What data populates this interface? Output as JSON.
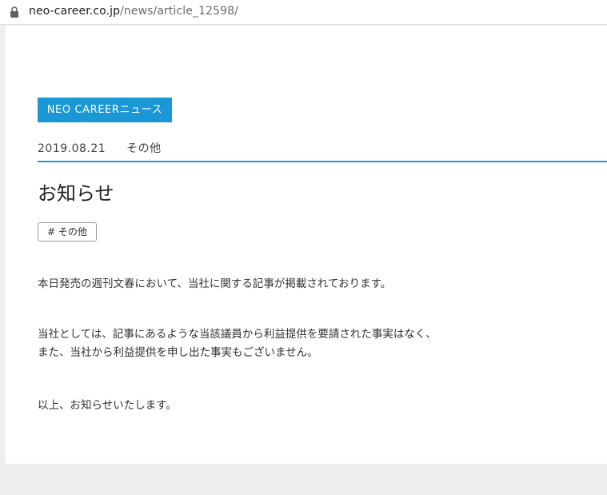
{
  "browser": {
    "url_domain": "neo-career.co.jp",
    "url_path": "/news/article_12598/"
  },
  "article": {
    "category_tag": "NEO CAREERニュース",
    "date": "2019.08.21",
    "category": "その他",
    "title": "お知らせ",
    "hashtag": "# その他",
    "paragraphs": {
      "p1": "本日発売の週刊文春において、当社に関する記事が掲載されております。",
      "p2_line1": "当社としては、記事にあるような当該議員から利益提供を要請された事実はなく、",
      "p2_line2": "また、当社から利益提供を申し出た事実もございません。",
      "p3": "以上、お知らせいたします。"
    }
  },
  "colors": {
    "accent": "#1a97d5",
    "page_bg": "#efefef"
  },
  "icons": {
    "lock": "lock-icon"
  }
}
